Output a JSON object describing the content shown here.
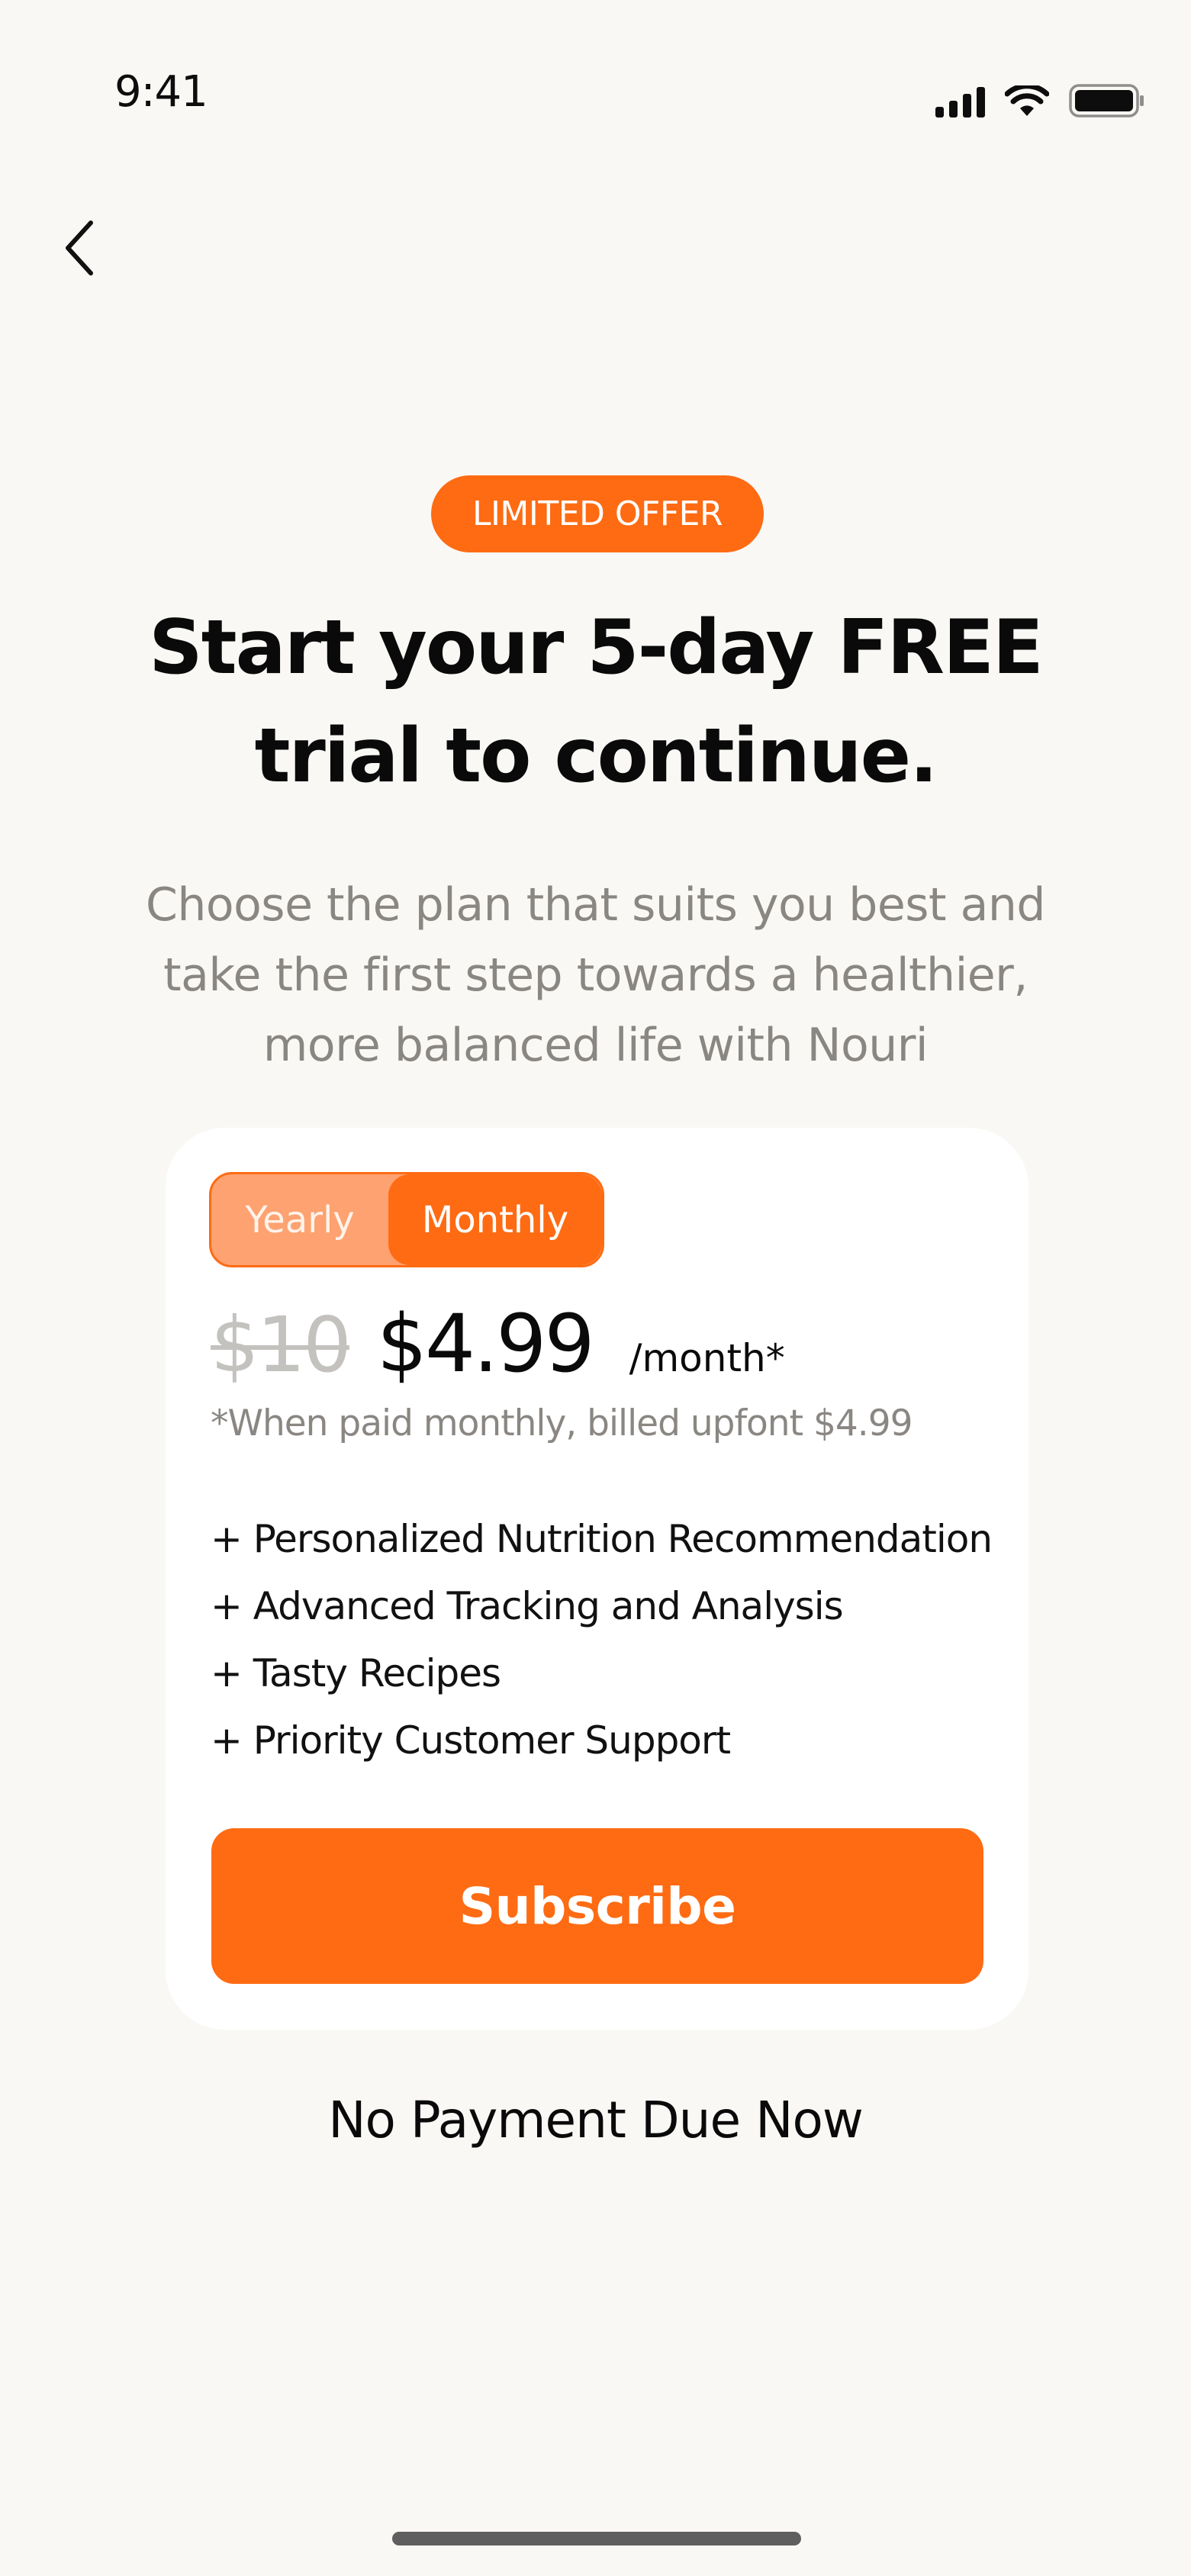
{
  "status_bar": {
    "time": "9:41",
    "icons": [
      "signal-icon",
      "wifi-icon",
      "battery-icon"
    ]
  },
  "navigation": {
    "back_icon": "chevron-left-icon"
  },
  "offer": {
    "badge": "LIMITED OFFER",
    "headline_line1": "Start your 5-day FREE",
    "headline_line2": "trial to continue.",
    "subtitle_line1": "Choose the plan that suits you best and",
    "subtitle_line2": "take the first step towards a healthier,",
    "subtitle_line3": "more balanced life with Nouri"
  },
  "plan": {
    "toggle": {
      "options": [
        "Yearly",
        "Monthly"
      ],
      "selected": "Monthly"
    },
    "old_price": "$10",
    "price": "$4.99",
    "period": "/month*",
    "note": "*When paid monthly, billed upfont $4.99",
    "features": [
      "+ Personalized Nutrition Recommendation",
      "+ Advanced Tracking and Analysis",
      "+ Tasty Recipes",
      "+ Priority Customer Support"
    ],
    "cta_label": "Subscribe"
  },
  "footer_note": "No Payment Due Now",
  "colors": {
    "accent": "#fe6b13",
    "accent_light": "#fda270",
    "background": "#f9f8f5",
    "card": "#ffffff",
    "muted_text": "#8a8783",
    "strike_text": "#c4c2bf"
  }
}
